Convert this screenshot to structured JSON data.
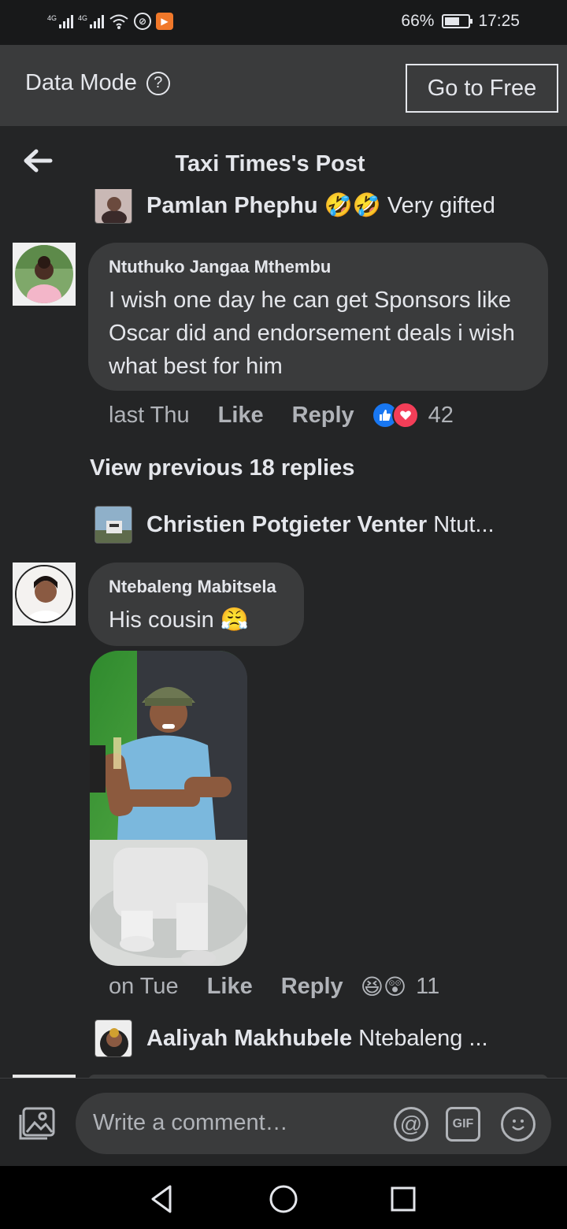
{
  "status_bar": {
    "signal_1": "4G",
    "signal_2": "4G",
    "battery": "66%",
    "battery_level": 0.66,
    "time": "17:25"
  },
  "data_mode": {
    "label": "Data Mode",
    "button": "Go to Free"
  },
  "header": {
    "title": "Taxi Times's Post"
  },
  "thread": {
    "top_reply": {
      "name": "Pamlan Phephu",
      "emoji": "🤣🤣",
      "text": "Very gifted"
    },
    "comment_1": {
      "name": "Ntuthuko Jangaa Mthembu",
      "text": "I wish one day he can get Sponsors like Oscar did and endorsement deals i wish what best for him",
      "time": "last Thu",
      "like": "Like",
      "reply": "Reply",
      "reaction_count": "42",
      "reaction_icons": [
        "like-icon",
        "love-icon"
      ]
    },
    "view_previous": "View previous 18 replies",
    "reply_1": {
      "name": "Christien Potgieter Venter",
      "text": "Ntut..."
    },
    "comment_2": {
      "name": "Ntebaleng Mabitsela",
      "text": "His cousin",
      "emoji": "😤",
      "time": "on Tue",
      "like": "Like",
      "reply": "Reply",
      "reaction_count": "11",
      "reaction_emojis": "😆😲"
    },
    "reply_2": {
      "name": "Aaliyah Makhubele",
      "text": "Ntebaleng ..."
    }
  },
  "composer": {
    "placeholder": "Write a comment…",
    "gif_label": "GIF",
    "at_symbol": "@"
  },
  "colors": {
    "background": "#242526",
    "bubble": "#3a3b3c",
    "text": "#e4e6eb",
    "muted": "#b0b3b8",
    "like_blue": "#1877f2",
    "love_red": "#f33e58"
  }
}
